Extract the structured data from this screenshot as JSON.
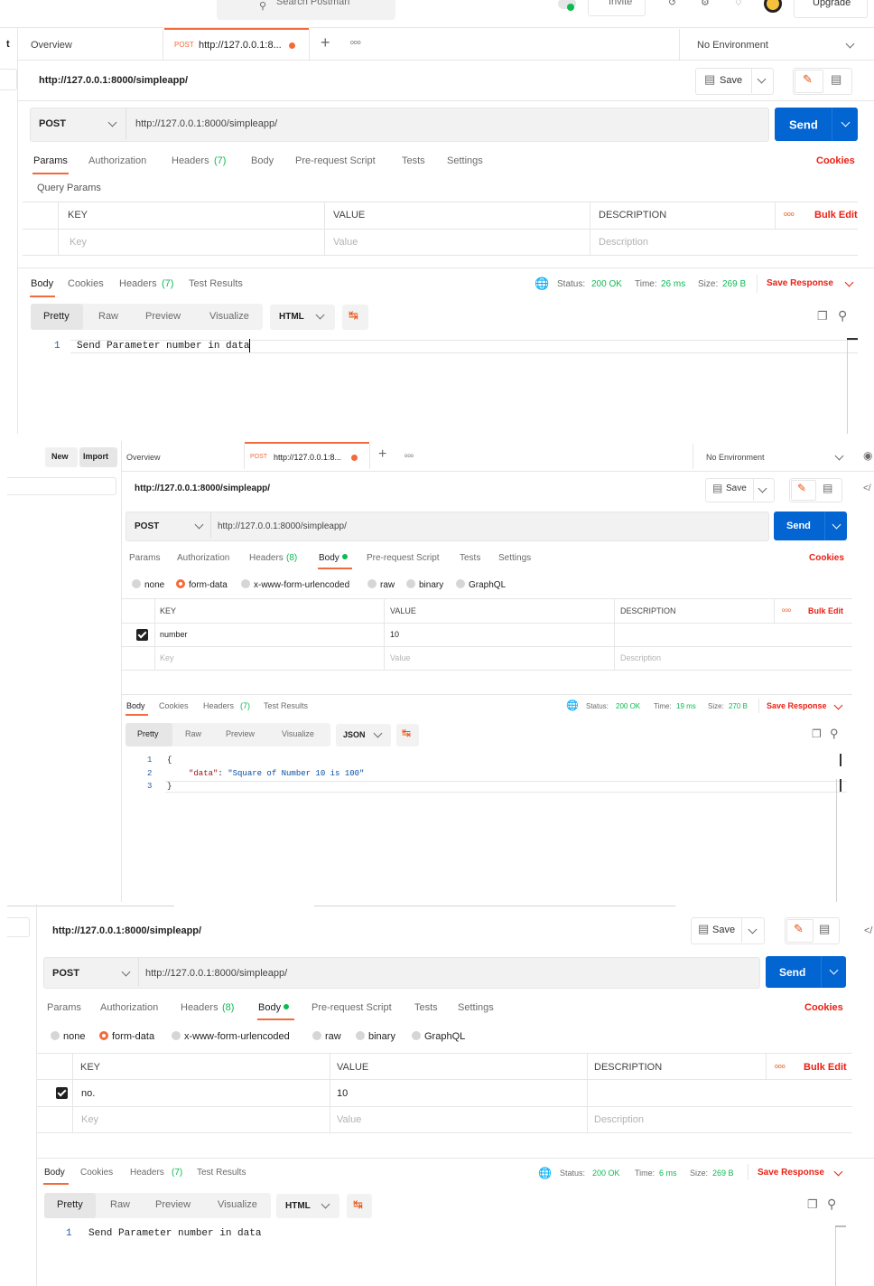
{
  "p1": {
    "search_placeholder": "Search Postman",
    "invite_label": "Invite",
    "upgrade_label": "Upgrade",
    "left_stub": "t",
    "tabs": {
      "overview": "Overview",
      "method": "POST",
      "url": "http://127.0.0.1:8...",
      "plus": "+",
      "more": "ooo"
    },
    "environment": "No Environment",
    "request_title": "http://127.0.0.1:8000/simpleapp/",
    "save_label": "Save",
    "method": "POST",
    "url": "http://127.0.0.1:8000/simpleapp/",
    "send_label": "Send",
    "req_tabs": {
      "params": "Params",
      "authorization": "Authorization",
      "headers": "Headers",
      "headers_count": "(7)",
      "body": "Body",
      "prerequest": "Pre-request Script",
      "tests": "Tests",
      "settings": "Settings",
      "cookies": "Cookies"
    },
    "query_params_label": "Query Params",
    "table": {
      "key": "KEY",
      "value": "VALUE",
      "description": "DESCRIPTION",
      "more": "ooo",
      "bulk_edit": "Bulk Edit",
      "key_ph": "Key",
      "value_ph": "Value",
      "desc_ph": "Description"
    },
    "resp_tabs": {
      "body": "Body",
      "cookies": "Cookies",
      "headers": "Headers",
      "headers_count": "(7)",
      "test_results": "Test Results"
    },
    "status": {
      "status_label": "Status:",
      "status_value": "200 OK",
      "time_label": "Time:",
      "time_value": "26 ms",
      "size_label": "Size:",
      "size_value": "269 B",
      "save_response": "Save Response"
    },
    "view": {
      "pretty": "Pretty",
      "raw": "Raw",
      "preview": "Preview",
      "visualize": "Visualize",
      "format": "HTML"
    },
    "code": [
      {
        "n": "1",
        "text": "Send Parameter number in data"
      }
    ]
  },
  "p2": {
    "new_label": "New",
    "import_label": "Import",
    "tabs": {
      "overview": "Overview",
      "method": "POST",
      "url": "http://127.0.0.1:8...",
      "plus": "+",
      "more": "ooo"
    },
    "environment": "No Environment",
    "request_title": "http://127.0.0.1:8000/simpleapp/",
    "save_label": "Save",
    "method": "POST",
    "url": "http://127.0.0.1:8000/simpleapp/",
    "send_label": "Send",
    "side_code": "</",
    "req_tabs": {
      "params": "Params",
      "authorization": "Authorization",
      "headers": "Headers",
      "headers_count": "(8)",
      "body": "Body",
      "prerequest": "Pre-request Script",
      "tests": "Tests",
      "settings": "Settings",
      "cookies": "Cookies"
    },
    "body_types": {
      "none": "none",
      "form_data": "form-data",
      "urlencoded": "x-www-form-urlencoded",
      "raw": "raw",
      "binary": "binary",
      "graphql": "GraphQL"
    },
    "table": {
      "key": "KEY",
      "value": "VALUE",
      "description": "DESCRIPTION",
      "more": "ooo",
      "bulk_edit": "Bulk Edit",
      "row_key": "number",
      "row_value": "10",
      "key_ph": "Key",
      "value_ph": "Value",
      "desc_ph": "Description"
    },
    "resp_tabs": {
      "body": "Body",
      "cookies": "Cookies",
      "headers": "Headers",
      "headers_count": "(7)",
      "test_results": "Test Results"
    },
    "status": {
      "status_label": "Status:",
      "status_value": "200 OK",
      "time_label": "Time:",
      "time_value": "19 ms",
      "size_label": "Size:",
      "size_value": "270 B",
      "save_response": "Save Response"
    },
    "view": {
      "pretty": "Pretty",
      "raw": "Raw",
      "preview": "Preview",
      "visualize": "Visualize",
      "format": "JSON"
    },
    "code": {
      "l1n": "1",
      "l1": "{",
      "l2n": "2",
      "l2_key": "\"data\"",
      "l2_colon": ": ",
      "l2_val": "\"Square of Number 10 is 100\"",
      "l3n": "3",
      "l3": "}"
    }
  },
  "p3": {
    "request_title": "http://127.0.0.1:8000/simpleapp/",
    "save_label": "Save",
    "method": "POST",
    "url": "http://127.0.0.1:8000/simpleapp/",
    "send_label": "Send",
    "side_code": "</",
    "req_tabs": {
      "params": "Params",
      "authorization": "Authorization",
      "headers": "Headers",
      "headers_count": "(8)",
      "body": "Body",
      "prerequest": "Pre-request Script",
      "tests": "Tests",
      "settings": "Settings",
      "cookies": "Cookies"
    },
    "body_types": {
      "none": "none",
      "form_data": "form-data",
      "urlencoded": "x-www-form-urlencoded",
      "raw": "raw",
      "binary": "binary",
      "graphql": "GraphQL"
    },
    "table": {
      "key": "KEY",
      "value": "VALUE",
      "description": "DESCRIPTION",
      "more": "ooo",
      "bulk_edit": "Bulk Edit",
      "row_key": "no.",
      "row_value": "10",
      "key_ph": "Key",
      "value_ph": "Value",
      "desc_ph": "Description"
    },
    "resp_tabs": {
      "body": "Body",
      "cookies": "Cookies",
      "headers": "Headers",
      "headers_count": "(7)",
      "test_results": "Test Results"
    },
    "status": {
      "status_label": "Status:",
      "status_value": "200 OK",
      "time_label": "Time:",
      "time_value": "6 ms",
      "size_label": "Size:",
      "size_value": "269 B",
      "save_response": "Save Response"
    },
    "view": {
      "pretty": "Pretty",
      "raw": "Raw",
      "preview": "Preview",
      "visualize": "Visualize",
      "format": "HTML"
    },
    "code": [
      {
        "n": "1",
        "text": "Send Parameter number in data"
      }
    ]
  }
}
